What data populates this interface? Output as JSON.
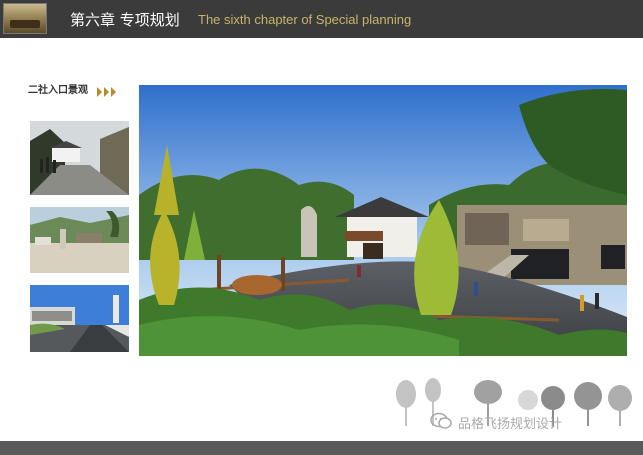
{
  "header": {
    "chapter_cn": "第六章  专项规划",
    "chapter_en": "The sixth chapter of Special planning"
  },
  "section": {
    "title": "二社入口景观"
  },
  "photos": [
    {
      "name": "site-photo-1"
    },
    {
      "name": "site-photo-2"
    },
    {
      "name": "site-photo-3"
    }
  ],
  "watermark": {
    "text": "品格飞扬规划设计",
    "icon": "wechat-icon"
  },
  "colors": {
    "header_bg": "#3b3b3b",
    "accent_gold": "#c8b46a",
    "arrow": "#b88a2a",
    "footer_bg": "#5a5a5a"
  }
}
